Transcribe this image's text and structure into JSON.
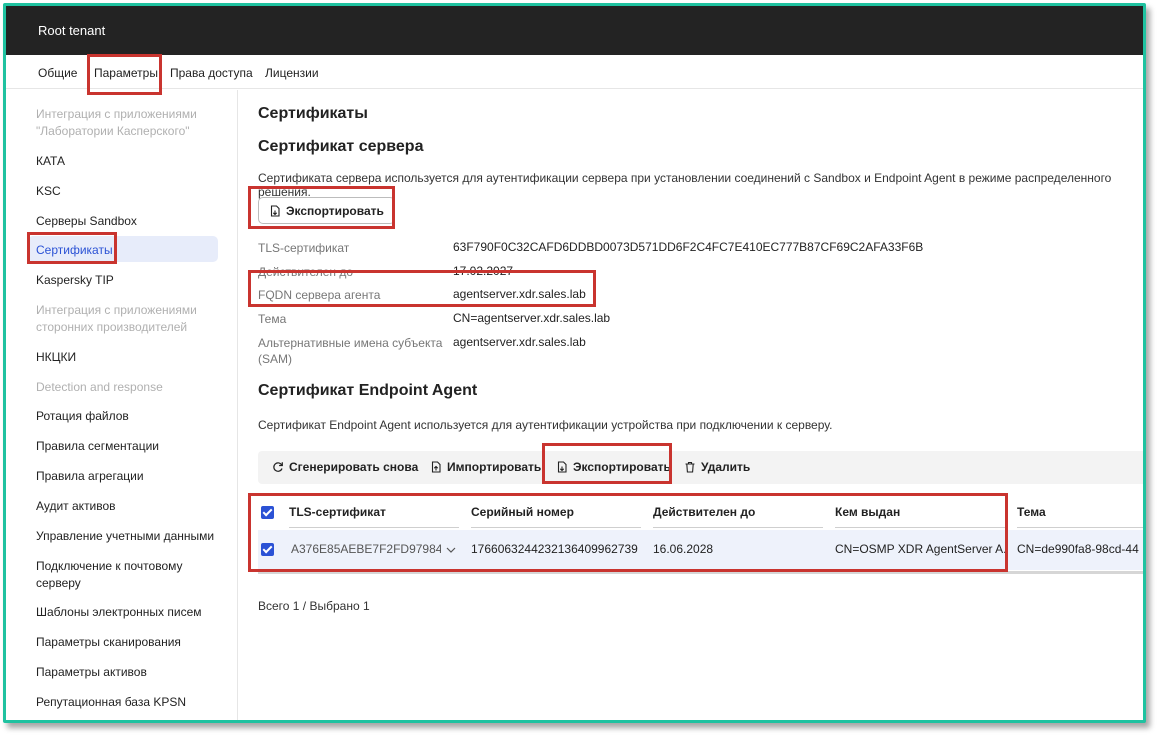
{
  "app": {
    "tenant": "Root tenant"
  },
  "tabs": [
    {
      "label": "Общие"
    },
    {
      "label": "Параметры"
    },
    {
      "label": "Права доступа"
    },
    {
      "label": "Лицензии"
    }
  ],
  "sidebar": {
    "items": [
      {
        "label": "Интеграция с приложениями \"Лаборатории Касперского\""
      },
      {
        "label": "КАТА"
      },
      {
        "label": "KSC"
      },
      {
        "label": "Серверы Sandbox"
      },
      {
        "label": "Сертификаты"
      },
      {
        "label": "Kaspersky TIP"
      },
      {
        "label": "Интеграция с приложениями сторонних производителей"
      },
      {
        "label": "НКЦКИ"
      },
      {
        "label": "Detection and response"
      },
      {
        "label": "Ротация файлов"
      },
      {
        "label": "Правила сегментации"
      },
      {
        "label": "Правила агрегации"
      },
      {
        "label": "Аудит активов"
      },
      {
        "label": "Управление учетными данными"
      },
      {
        "label": "Подключение к почтовому серверу"
      },
      {
        "label": "Шаблоны электронных писем"
      },
      {
        "label": "Параметры сканирования"
      },
      {
        "label": "Параметры активов"
      },
      {
        "label": "Репутационная база KPSN"
      }
    ]
  },
  "main": {
    "title": "Сертификаты",
    "server": {
      "heading": "Сертификат сервера",
      "description": "Сертификата сервера используется для аутентификации сервера при установлении соединений с Sandbox и Endpoint Agent в режиме распределенного решения.",
      "export_label": "Экспортировать",
      "fields": [
        {
          "label": "TLS-сертификат",
          "value": "63F790F0C32CAFD6DDBD0073D571DD6F2C4FC7E410EC777B87CF69C2AFA33F6B"
        },
        {
          "label": "Действителен до",
          "value": "17.02.2027"
        },
        {
          "label": "FQDN сервера агента",
          "value": "agentserver.xdr.sales.lab"
        },
        {
          "label": "Тема",
          "value": "CN=agentserver.xdr.sales.lab"
        },
        {
          "label": "Альтернативные имена субъекта (SAM)",
          "value": "agentserver.xdr.sales.lab"
        }
      ]
    },
    "agent": {
      "heading": "Сертификат Endpoint Agent",
      "description": "Сертификат Endpoint Agent используется для аутентификации устройства при подключении к серверу.",
      "toolbar": {
        "regenerate": "Сгенерировать снова",
        "import": "Импортировать",
        "export": "Экспортировать",
        "delete": "Удалить"
      },
      "table": {
        "columns": [
          "TLS-сертификат",
          "Серийный номер",
          "Действителен до",
          "Кем выдан",
          "Тема"
        ],
        "rows": [
          {
            "tls": "A376E85AEBE7F2FD97984",
            "serial": "1766063244232136409962739",
            "valid_to": "16.06.2028",
            "issuer": "CN=OSMP XDR AgentServer A...",
            "subject": "CN=de990fa8-98cd-44"
          }
        ]
      },
      "summary": "Всего 1 / Выбрано 1"
    }
  },
  "colors": {
    "accent": "#2b52d5",
    "highlight": "#c9342f",
    "frame": "#1fc2a0",
    "topbar": "#232323"
  }
}
